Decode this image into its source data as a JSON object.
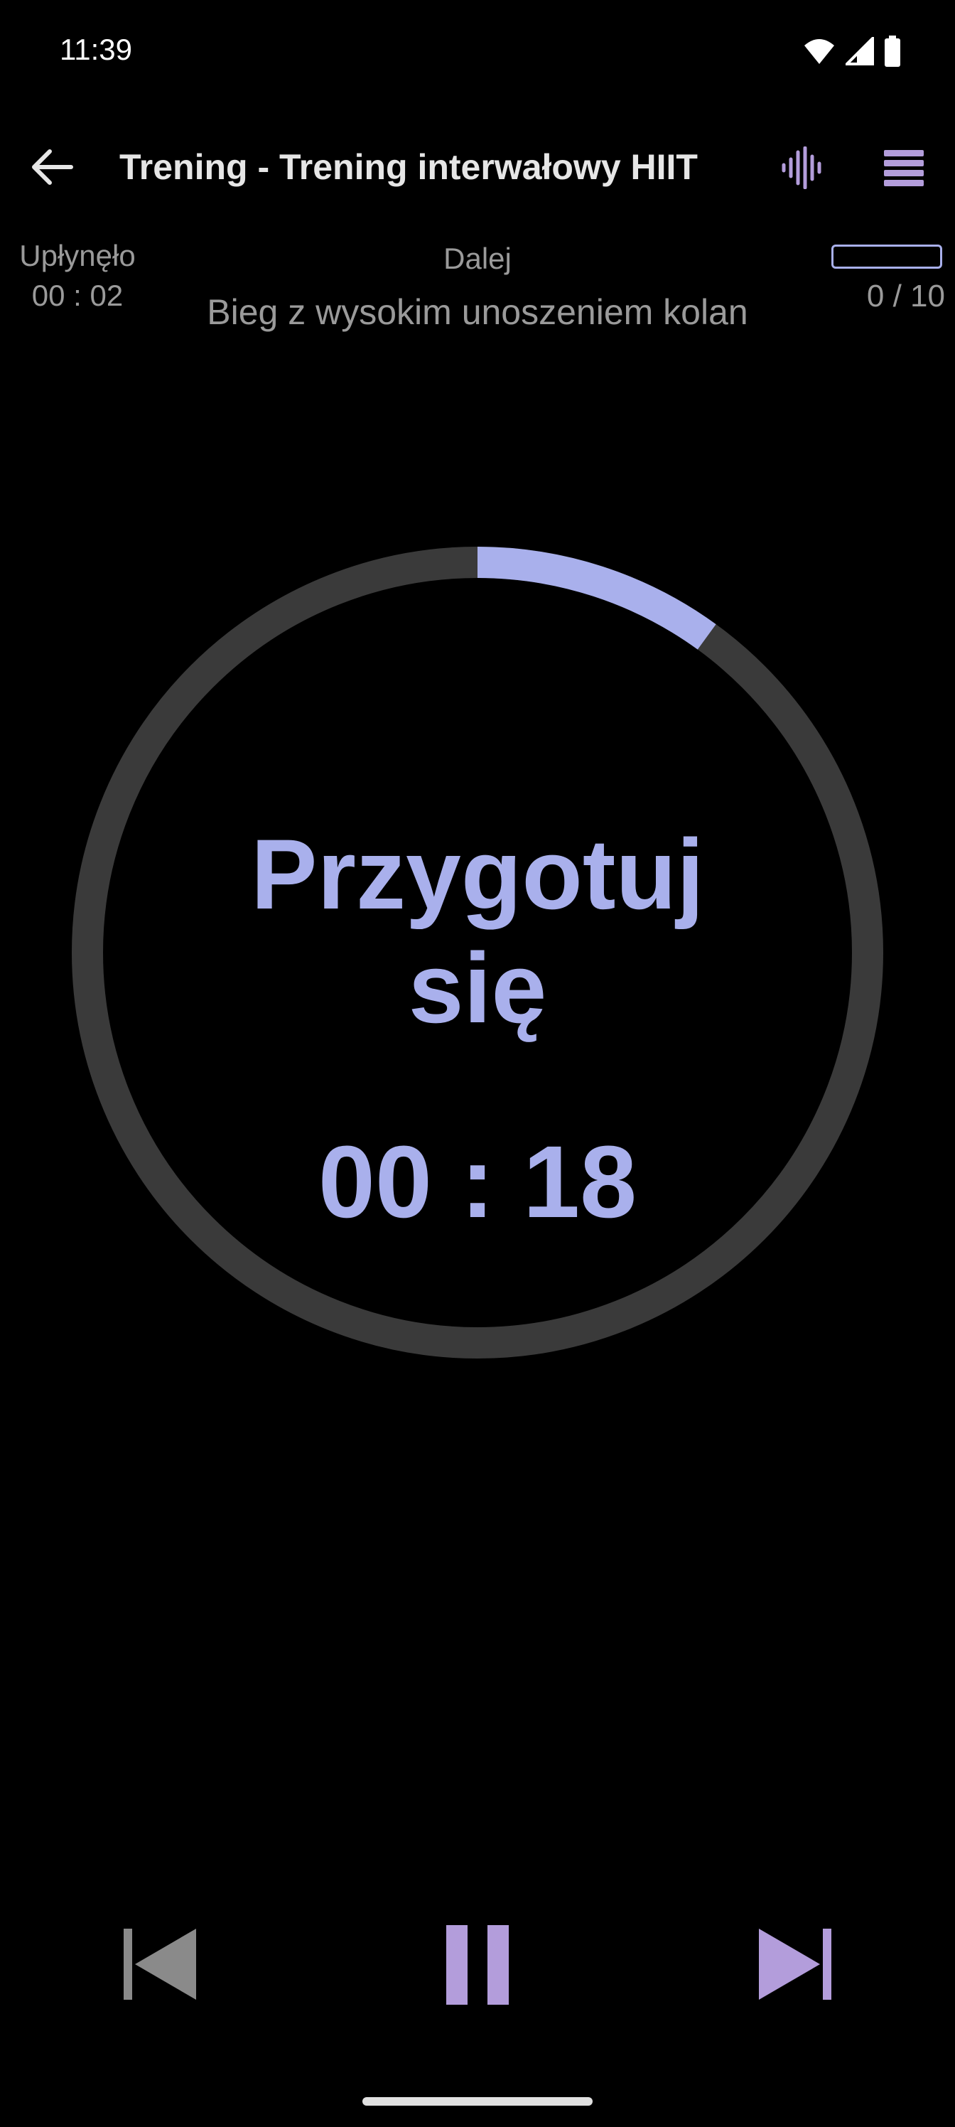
{
  "status_bar": {
    "time": "11:39",
    "icons": [
      "wifi-icon",
      "signal-icon",
      "battery-icon"
    ]
  },
  "app_bar": {
    "title": "Trening - Trening interwałowy HIIT",
    "back_icon": "arrow-left-icon",
    "voice_icon": "audio-waveform-icon",
    "menu_icon": "list-menu-icon"
  },
  "info": {
    "elapsed_label": "Upłynęło",
    "elapsed_value": "00 : 02",
    "next_label": "Dalej",
    "next_exercise": "Bieg z wysokim unoszeniem kolan",
    "progress_count": "0 / 10",
    "progress_fraction": 0
  },
  "timer": {
    "phase_line1": "Przygotuj",
    "phase_line2": "się",
    "countdown": "00 : 18",
    "ring_progress": 0.1
  },
  "controls": {
    "prev_icon": "skip-previous-icon",
    "pause_icon": "pause-icon",
    "next_icon": "skip-next-icon"
  },
  "colors": {
    "accent": "#a9b0ec",
    "accent_purple": "#b39ddb",
    "ring_track": "#3a3a3a",
    "secondary_text": "#9a9a9a",
    "disabled": "#8a8a8a",
    "background": "#000000"
  }
}
